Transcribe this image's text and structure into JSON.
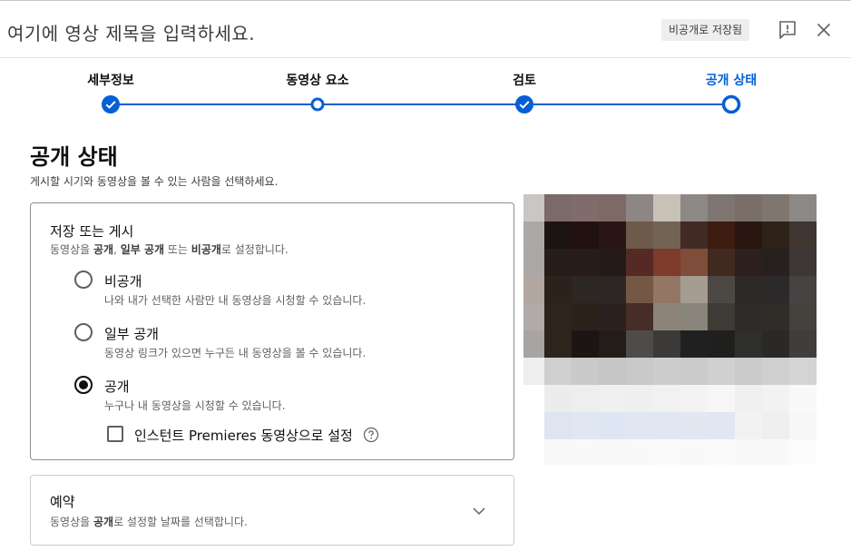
{
  "header": {
    "title": "여기에 영상 제목을 입력하세요.",
    "save_status": "비공개로 저장됨",
    "feedback_icon": "feedback-icon",
    "close_icon": "close-icon"
  },
  "stepper": {
    "steps": [
      {
        "label": "세부정보",
        "state": "done"
      },
      {
        "label": "동영상 요소",
        "state": "visited"
      },
      {
        "label": "검토",
        "state": "done"
      },
      {
        "label": "공개 상태",
        "state": "active"
      }
    ],
    "accent": "#065fd4"
  },
  "visibility": {
    "title": "공개 상태",
    "subtitle": "게시할 시기와 동영상을 볼 수 있는 사람을 선택하세요.",
    "save_card": {
      "title": "저장 또는 게시",
      "desc_prefix": "동영상을 ",
      "desc_public": "공개",
      "desc_sep1": ", ",
      "desc_unlisted": "일부 공개",
      "desc_mid": " 또는 ",
      "desc_private": "비공개",
      "desc_suffix": "로 설정합니다.",
      "options": [
        {
          "label": "비공개",
          "desc": "나와 내가 선택한 사람만 내 동영상을 시청할 수 있습니다.",
          "checked": false
        },
        {
          "label": "일부 공개",
          "desc": "동영상 링크가 있으면 누구든 내 동영상을 볼 수 있습니다.",
          "checked": false
        },
        {
          "label": "공개",
          "desc": "누구나 내 동영상을 시청할 수 있습니다.",
          "checked": true
        }
      ],
      "premiere_checkbox": {
        "label": "인스턴트 Premieres 동영상으로 설정",
        "checked": false
      }
    },
    "schedule_card": {
      "title": "예약",
      "desc_prefix": "동영상을 ",
      "desc_bold": "공개",
      "desc_suffix": "로 설정할 날짜를 선택합니다."
    }
  },
  "thumbnail": {
    "colors": [
      [
        "#c9c6c4",
        "#7c6a68",
        "#806c6b",
        "#7d6966",
        "#8d8684",
        "#c8c1b8",
        "#8c8886",
        "#7f7672",
        "#7a6e68",
        "#7e766f",
        "#8c8886"
      ],
      [
        "#aba9a8",
        "#1c1412",
        "#211110",
        "#2a1615",
        "#6e5a4a",
        "#726354",
        "#412b24",
        "#3e1c12",
        "#2a1611",
        "#2f2218",
        "#3f3531"
      ],
      [
        "#aba7a6",
        "#261d19",
        "#271c19",
        "#241a18",
        "#552924",
        "#7e3a2b",
        "#7f4d39",
        "#41291f",
        "#2e201e",
        "#27201f",
        "#3c3734"
      ],
      [
        "#b1a6a0",
        "#2b221c",
        "#2d2723",
        "#2c2725",
        "#745745",
        "#947665",
        "#a59c92",
        "#4c4945",
        "#2c2927",
        "#2b2929",
        "#464442"
      ],
      [
        "#b0aba9",
        "#2d241d",
        "#2c211b",
        "#2b2220",
        "#462d28",
        "#8c8479",
        "#89857a",
        "#3e3b36",
        "#2e2b28",
        "#302d29",
        "#45423d"
      ],
      [
        "#a8a4a3",
        "#2e241b",
        "#1d1513",
        "#221d19",
        "#4e4c4b",
        "#3b3a39",
        "#212020",
        "#1f1f1e",
        "#2e2e2d",
        "#2a2928",
        "#3f3e3d"
      ],
      [
        "#eeeeee",
        "#cfcfcf",
        "#c9c9c9",
        "#c6c6c6",
        "#c9c9c9",
        "#cdcdcd",
        "#cbcbcb",
        "#d0d0d0",
        "#cacaca",
        "#cfcfcf",
        "#d4d4d4"
      ],
      [
        "#ffffff",
        "#ececec",
        "#eeeeee",
        "#f0f0f0",
        "#efefef",
        "#f1f1f1",
        "#f3f3f3",
        "#f6f6f6",
        "#f0f0f0",
        "#f2f2f2",
        "#f9f9f9"
      ],
      [
        "#ffffff",
        "#dfe5f0",
        "#e0e6f2",
        "#dfe6f3",
        "#e0e7f3",
        "#e0e6f2",
        "#e2e7f2",
        "#e1e7f2",
        "#f2f2f2",
        "#efefef",
        "#f7f7f7"
      ],
      [
        "#ffffff",
        "#f8f8f8",
        "#f9f9f9",
        "#f8f8f8",
        "#f9f9f9",
        "#fafafa",
        "#f9f9f9",
        "#fafafa",
        "#f8f8f8",
        "#f9f9f9",
        "#fbfbfb"
      ]
    ]
  }
}
